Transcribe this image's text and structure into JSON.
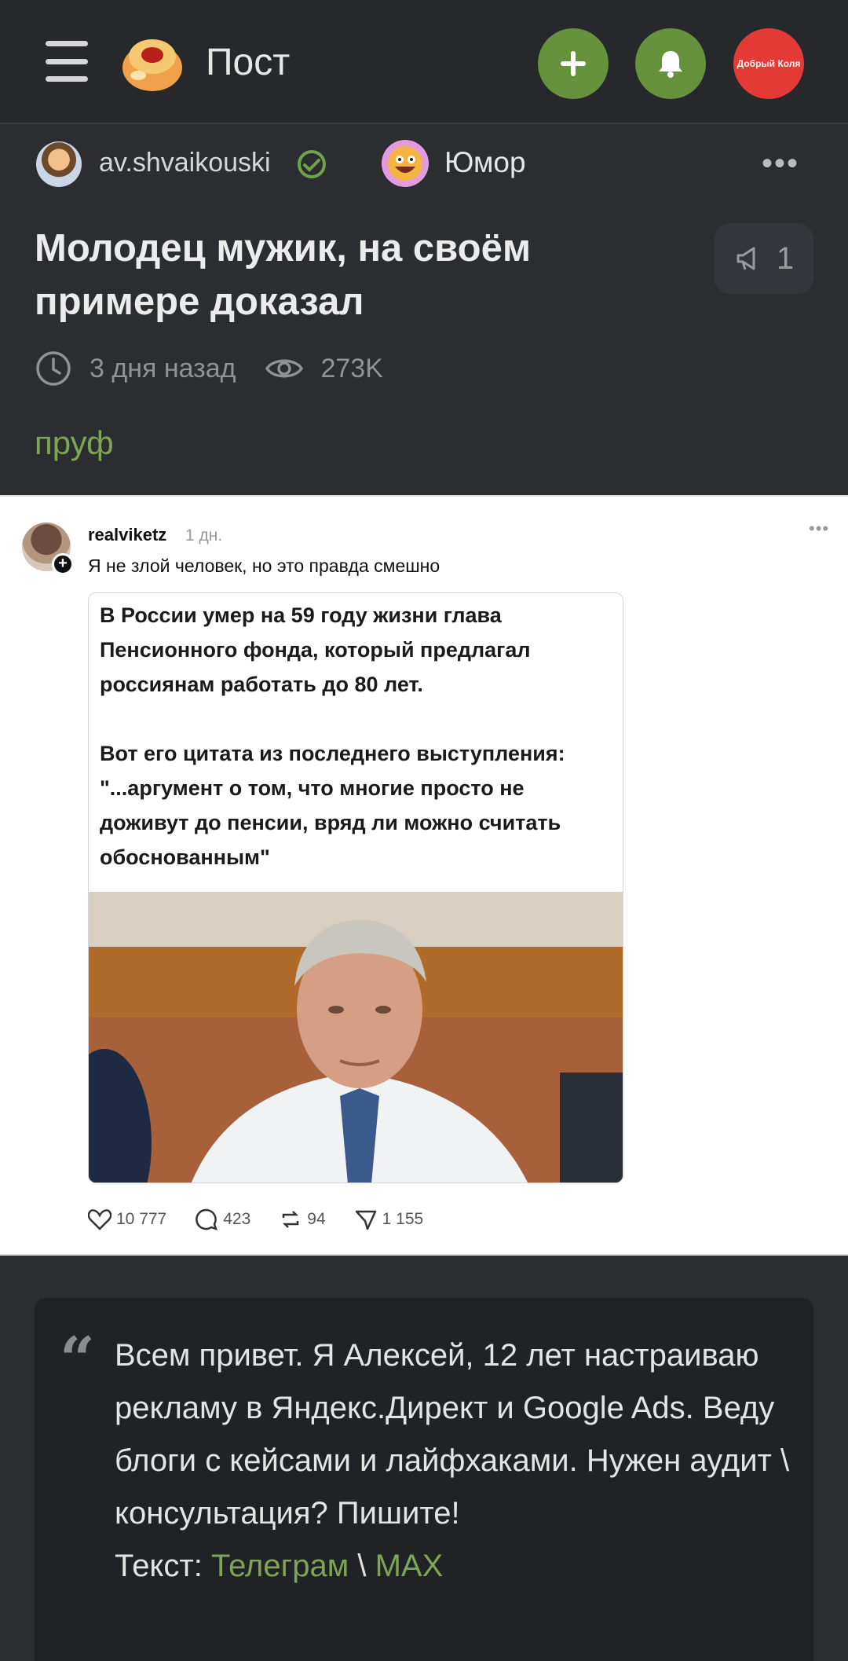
{
  "app_bar": {
    "title": "Пост",
    "profile_label": "Добрый Коля"
  },
  "post": {
    "author": "av.shvaikouski",
    "community": "Юмор",
    "title": "Молодец мужик, на своём примере доказал",
    "share_count": "1",
    "time_ago": "3 дня назад",
    "views": "273K",
    "tag": "пруф"
  },
  "embed": {
    "username": "realviketz",
    "time": "1 дн.",
    "caption": "Я не злой человек, но это правда смешно",
    "quote_text": "В России умер на 59 году жизни глава Пенсионного фонда, который предлагал россиянам работать до 80 лет.\n\nВот его цитата из последнего выступления: \"...аргумент о том, что многие просто не доживут до пенсии, вряд ли можно считать обоснованным\"",
    "likes": "10 777",
    "comments": "423",
    "reposts": "94",
    "shares": "1 155"
  },
  "promo": {
    "line1": "Всем привет. Я Алексей, 12 лет настраиваю рекламу в Яндекс.Директ и Google Ads. Веду блоги с кейсами и лайфхаками. Нужен аудит \\ консультация? Пишите!",
    "text_prefix": "Текст: ",
    "link_telegram": "Телеграм",
    "separator": " \\ ",
    "link_max": "MAX"
  },
  "colors": {
    "accent_green": "#66913d",
    "link_green": "#7ea555",
    "background": "#2b2d31",
    "profile_red": "#e43a35"
  }
}
